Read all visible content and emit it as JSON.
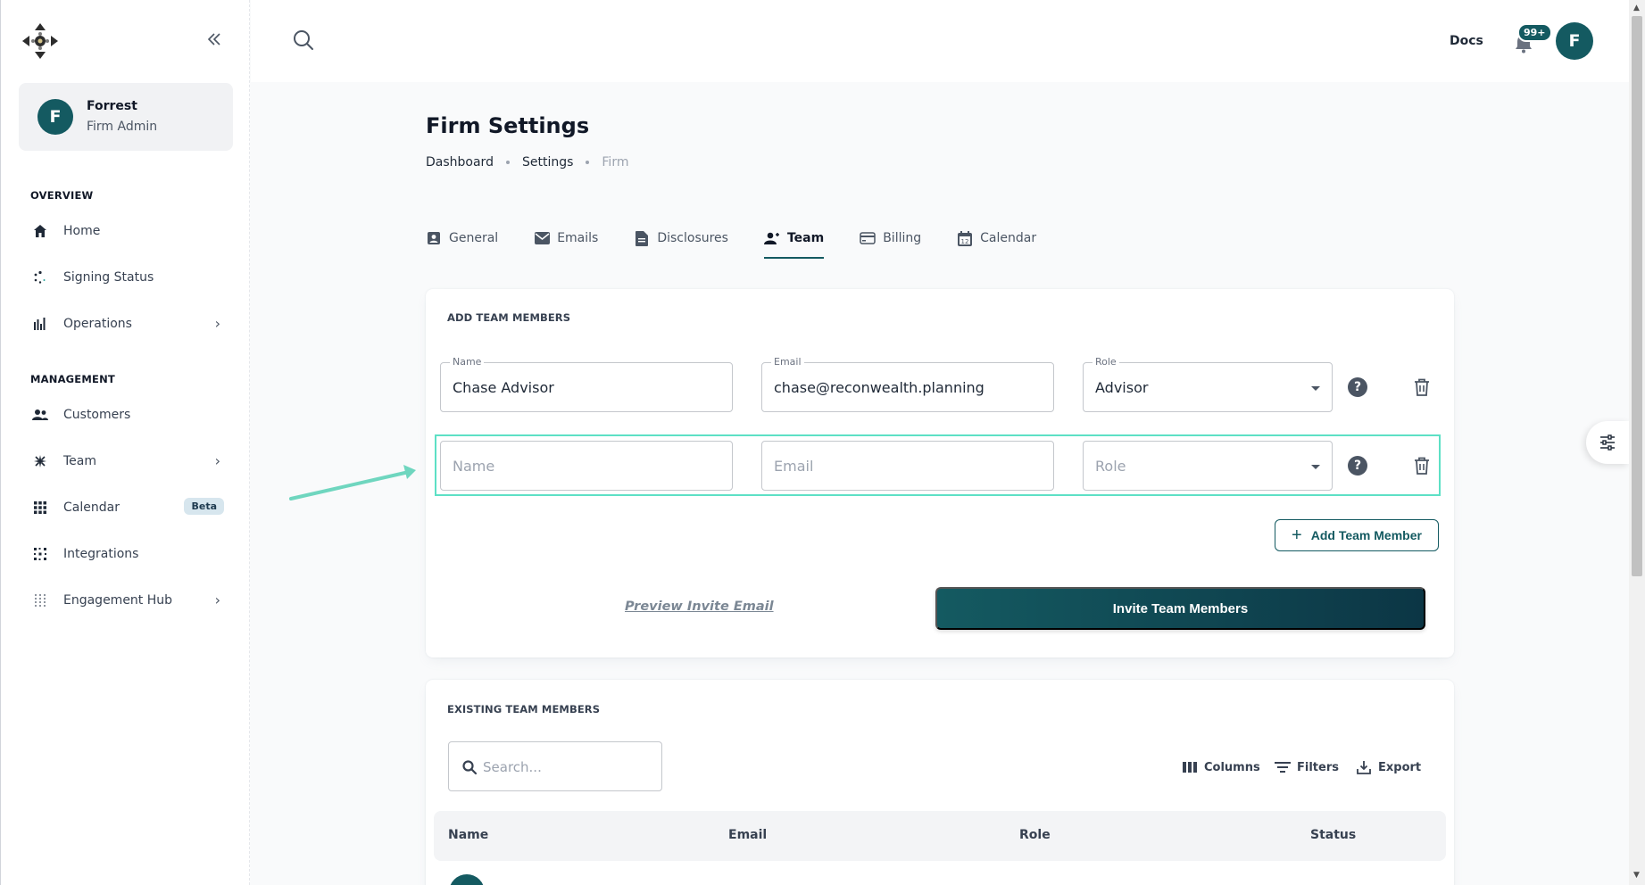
{
  "sidebar": {
    "user": {
      "initial": "F",
      "name": "Forrest",
      "role": "Firm Admin"
    },
    "sections": [
      {
        "label": "OVERVIEW"
      },
      {
        "label": "MANAGEMENT"
      }
    ],
    "overview_items": [
      {
        "label": "Home",
        "icon": "home-icon"
      },
      {
        "label": "Signing Status",
        "icon": "spinner-icon"
      },
      {
        "label": "Operations",
        "icon": "bar-chart-icon",
        "has_chevron": true
      }
    ],
    "management_items": [
      {
        "label": "Customers",
        "icon": "users-icon"
      },
      {
        "label": "Team",
        "icon": "team-icon",
        "has_chevron": true
      },
      {
        "label": "Calendar",
        "icon": "grid-icon",
        "badge": "Beta"
      },
      {
        "label": "Integrations",
        "icon": "integrations-icon"
      },
      {
        "label": "Engagement Hub",
        "icon": "dots-grid-icon",
        "has_chevron": true
      }
    ]
  },
  "header": {
    "docs_label": "Docs",
    "notification_count": "99+",
    "avatar_initial": "F"
  },
  "page": {
    "title": "Firm Settings",
    "breadcrumb": [
      "Dashboard",
      "Settings",
      "Firm"
    ]
  },
  "tabs": [
    {
      "label": "General",
      "icon": "contact-icon"
    },
    {
      "label": "Emails",
      "icon": "mail-icon"
    },
    {
      "label": "Disclosures",
      "icon": "document-icon"
    },
    {
      "label": "Team",
      "icon": "team-icon",
      "active": true
    },
    {
      "label": "Billing",
      "icon": "credit-card-icon"
    },
    {
      "label": "Calendar",
      "icon": "calendar-icon"
    }
  ],
  "add_members": {
    "title": "ADD TEAM MEMBERS",
    "rows": [
      {
        "name_label": "Name",
        "name_value": "Chase Advisor",
        "email_label": "Email",
        "email_value": "chase@reconwealth.planning",
        "role_label": "Role",
        "role_value": "Advisor"
      },
      {
        "name_placeholder": "Name",
        "email_placeholder": "Email",
        "role_placeholder": "Role"
      }
    ],
    "add_button": "Add Team Member",
    "preview_link": "Preview Invite Email",
    "invite_button": "Invite Team Members"
  },
  "existing_members": {
    "title": "EXISTING TEAM MEMBERS",
    "search_placeholder": "Search...",
    "toolbar": {
      "columns": "Columns",
      "filters": "Filters",
      "export": "Export"
    },
    "columns": [
      "Name",
      "Email",
      "Role",
      "Status"
    ]
  },
  "colors": {
    "brand": "#145a61",
    "highlight": "#5de0c5"
  }
}
